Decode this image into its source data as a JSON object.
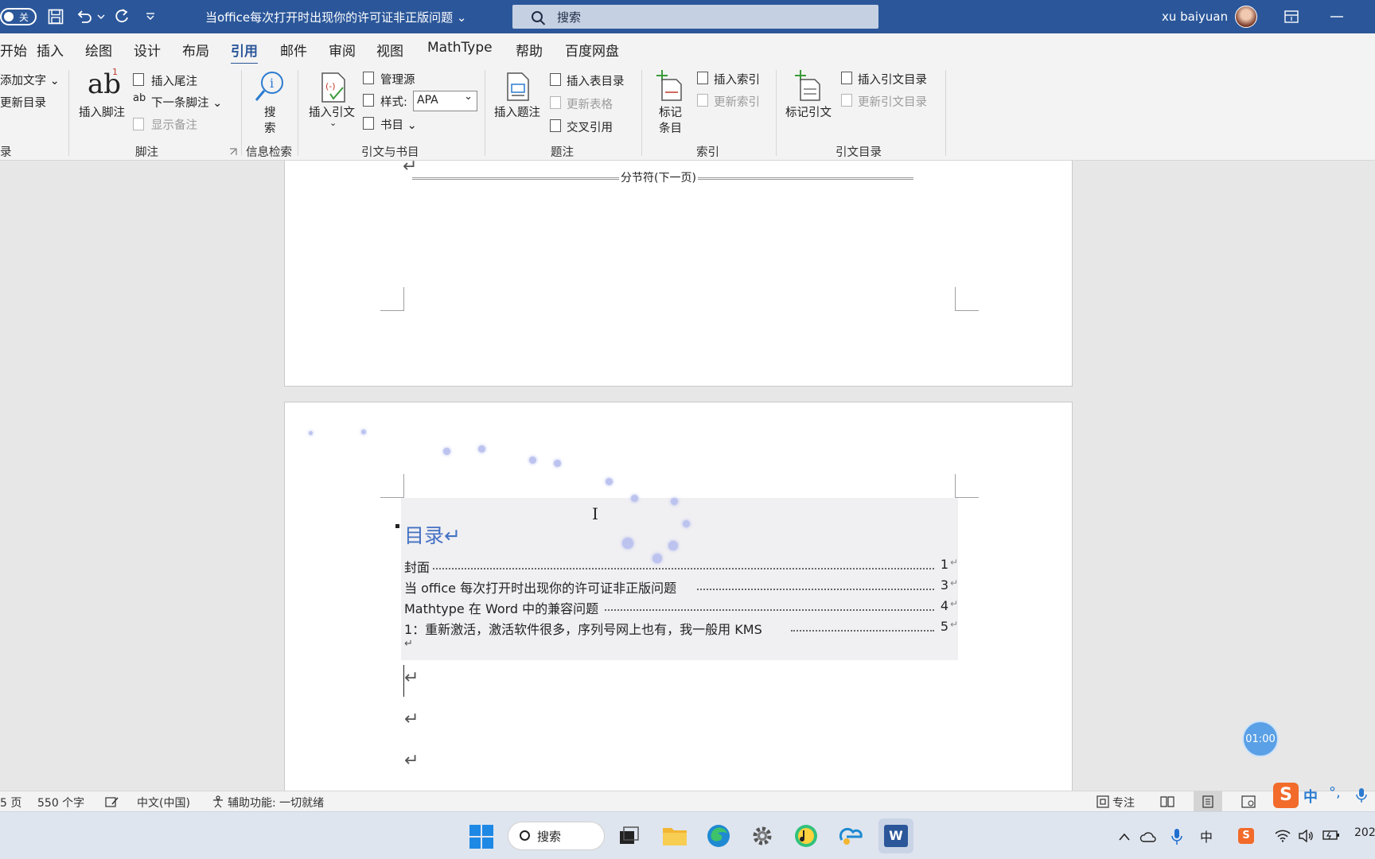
{
  "titlebar": {
    "toggle_label": "关",
    "doc_title": "当office每次打开时出现你的许可证非正版问题 ⌄",
    "search_placeholder": "搜索",
    "user_name": "xu baiyuan"
  },
  "menu": {
    "tabs": [
      "开始",
      "插入",
      "绘图",
      "设计",
      "布局",
      "引用",
      "邮件",
      "审阅",
      "视图",
      "MathType",
      "帮助",
      "百度网盘"
    ],
    "active": "引用"
  },
  "ribbon": {
    "toc_group": {
      "add_text": "添加文字 ⌄",
      "update_toc": "更新目录",
      "label": "录"
    },
    "footnote_group": {
      "insert_footnote": "插入脚注",
      "insert_endnote": "插入尾注",
      "next_footnote": "下一条脚注 ⌄",
      "show_notes": "显示备注",
      "label": "脚注"
    },
    "research_group": {
      "search_line1": "搜",
      "search_line2": "索",
      "label": "信息检索"
    },
    "citation_group": {
      "insert_citation": "插入引文",
      "manage_sources": "管理源",
      "style_label": "样式:",
      "style_value": "APA",
      "bibliography": "书目 ⌄",
      "label": "引文与书目"
    },
    "caption_group": {
      "insert_caption": "插入题注",
      "insert_table_of_figures": "插入表目录",
      "update_table": "更新表格",
      "cross_reference": "交叉引用",
      "label": "题注"
    },
    "index_group": {
      "mark_entry_line1": "标记",
      "mark_entry_line2": "条目",
      "insert_index": "插入索引",
      "update_index": "更新索引",
      "label": "索引"
    },
    "authorities_group": {
      "mark_citation": "标记引文",
      "insert_table_of_authorities": "插入引文目录",
      "update_table": "更新引文目录",
      "label": "引文目录"
    }
  },
  "document": {
    "section_break": "分节符(下一页)",
    "toc_title": "目录↵",
    "toc_entries": [
      {
        "label": "封面",
        "page": "1"
      },
      {
        "label": "当 office 每次打开时出现你的许可证非正版问题",
        "page": "3"
      },
      {
        "label": "Mathtype 在 Word 中的兼容问题",
        "page": "4"
      },
      {
        "label": "1：重新激活，激活软件很多，序列号网上也有，我一般用 KMS",
        "page": "5"
      }
    ],
    "return_mark": "↵",
    "timer": "01:00"
  },
  "statusbar": {
    "page_info": "5 页",
    "word_count": "550 个字",
    "language": "中文(中国)",
    "accessibility": "辅助功能: 一切就绪",
    "focus": "专注"
  },
  "taskbar": {
    "search_label": "搜索",
    "ime_label": "中",
    "clock": "202"
  },
  "colors": {
    "title_bar": "#2b579a",
    "accent": "#2b579a",
    "toc_heading": "#4472c4"
  }
}
